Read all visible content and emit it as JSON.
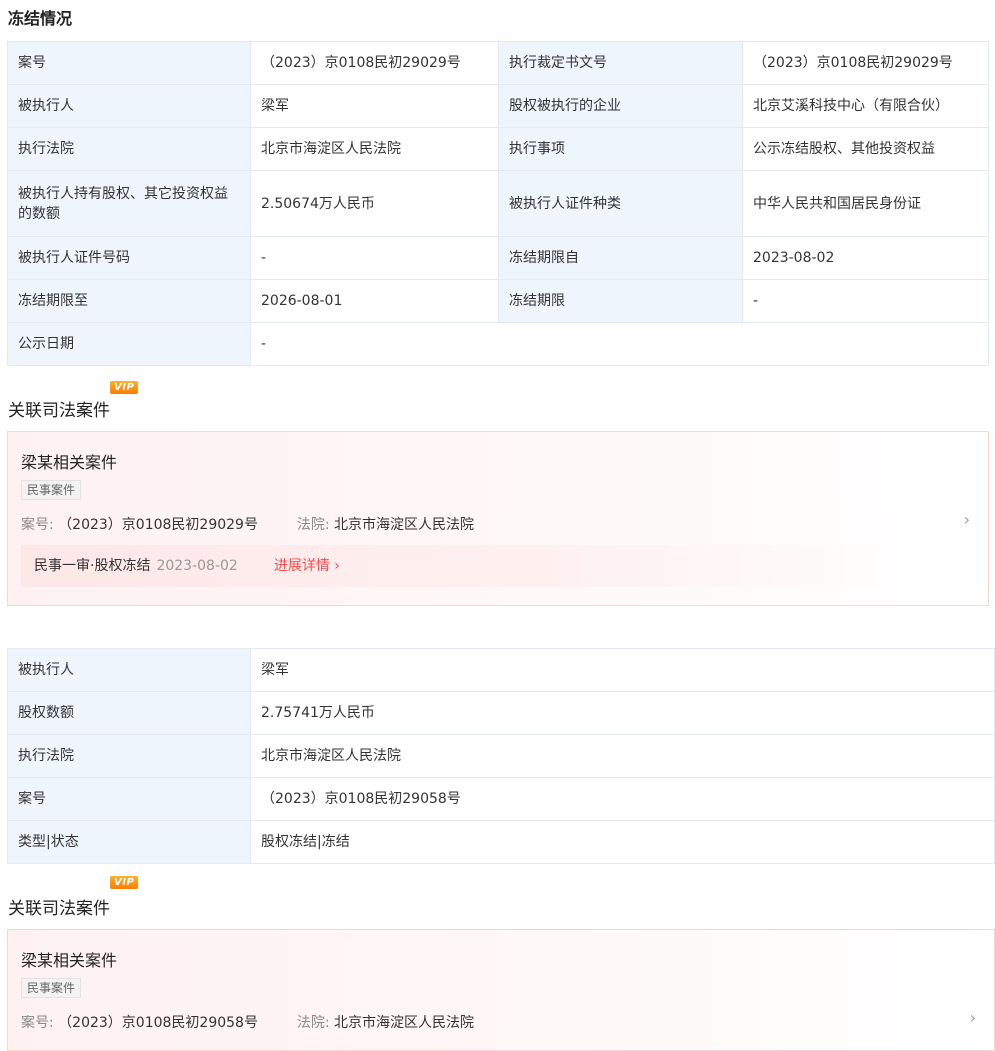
{
  "section_title": "冻结情况",
  "freeze_table": {
    "rows": [
      [
        {
          "label": "案号"
        },
        {
          "value": "（2023）京0108民初29029号",
          "link": true
        },
        {
          "label": "执行裁定书文号"
        },
        {
          "value": "（2023）京0108民初29029号"
        }
      ],
      [
        {
          "label": "被执行人"
        },
        {
          "value": "梁军",
          "link": true
        },
        {
          "label": "股权被执行的企业"
        },
        {
          "value": "北京艾溪科技中心（有限合伙）",
          "link": true
        }
      ],
      [
        {
          "label": "执行法院"
        },
        {
          "value": "北京市海淀区人民法院"
        },
        {
          "label": "执行事项"
        },
        {
          "value": "公示冻结股权、其他投资权益"
        }
      ],
      [
        {
          "label": "被执行人持有股权、其它投资权益的数额"
        },
        {
          "value": "2.50674万人民币"
        },
        {
          "label": "被执行人证件种类"
        },
        {
          "value": "中华人民共和国居民身份证"
        }
      ],
      [
        {
          "label": "被执行人证件号码"
        },
        {
          "value": "-"
        },
        {
          "label": "冻结期限自"
        },
        {
          "value": "2023-08-02"
        }
      ],
      [
        {
          "label": "冻结期限至"
        },
        {
          "value": "2026-08-01"
        },
        {
          "label": "冻结期限"
        },
        {
          "value": "-"
        }
      ],
      [
        {
          "label": "公示日期"
        },
        {
          "value": "-"
        }
      ]
    ]
  },
  "related_title": "关联司法案件",
  "vip_badge": "VIP",
  "case_card_1": {
    "title": "梁某相关案件",
    "tag": "民事案件",
    "case_no_label": "案号:",
    "case_no": "（2023）京0108民初29029号",
    "court_label": "法院:",
    "court": "北京市海淀区人民法院",
    "stage": "民事一审·股权冻结",
    "date": "2023-08-02",
    "detail_label": "进展详情 ›"
  },
  "holder_table": {
    "rows": [
      {
        "label": "被执行人",
        "value": "梁军",
        "link": true
      },
      {
        "label": "股权数额",
        "value": "2.75741万人民币"
      },
      {
        "label": "执行法院",
        "value": "北京市海淀区人民法院"
      },
      {
        "label": "案号",
        "value": "（2023）京0108民初29058号",
        "link": true
      },
      {
        "label": "类型|状态",
        "value": "股权冻结|冻结"
      }
    ]
  },
  "case_card_2": {
    "title": "梁某相关案件",
    "tag": "民事案件",
    "case_no_label": "案号:",
    "case_no": "（2023）京0108民初29058号",
    "court_label": "法院:",
    "court": "北京市海淀区人民法院"
  },
  "chevron_glyph": "›"
}
